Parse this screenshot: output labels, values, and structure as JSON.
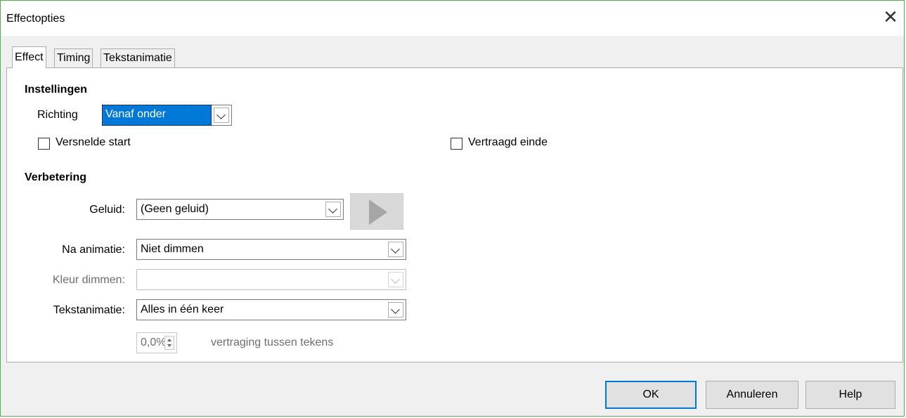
{
  "dialog": {
    "title": "Effectopties",
    "close_glyph": "✕"
  },
  "tabs": [
    {
      "label": "Effect",
      "active": true
    },
    {
      "label": "Timing",
      "active": false
    },
    {
      "label": "Tekstanimatie",
      "active": false
    }
  ],
  "instellingen": {
    "heading": "Instellingen",
    "richting_label": "Richting",
    "richting_value": "Vanaf onder",
    "versnelde_start": {
      "label": "Versnelde start",
      "checked": false
    },
    "vertraagd_einde": {
      "label": "Vertraagd einde",
      "checked": false
    }
  },
  "verbetering": {
    "heading": "Verbetering",
    "geluid_label": "Geluid:",
    "geluid_value": "(Geen geluid)",
    "play_icon": "play-icon",
    "na_animatie_label": "Na animatie:",
    "na_animatie_value": "Niet dimmen",
    "kleur_dimmen_label": "Kleur dimmen:",
    "kleur_dimmen_value": "",
    "tekstanimatie_label": "Tekstanimatie:",
    "tekstanimatie_value": "Alles in één keer",
    "vertraging_value": "0,0%",
    "vertraging_label": "vertraging tussen tekens"
  },
  "buttons": {
    "ok": "OK",
    "annuleren": "Annuleren",
    "help": "Help"
  },
  "colors": {
    "selection": "#0078d7",
    "border": "#4caf50"
  }
}
